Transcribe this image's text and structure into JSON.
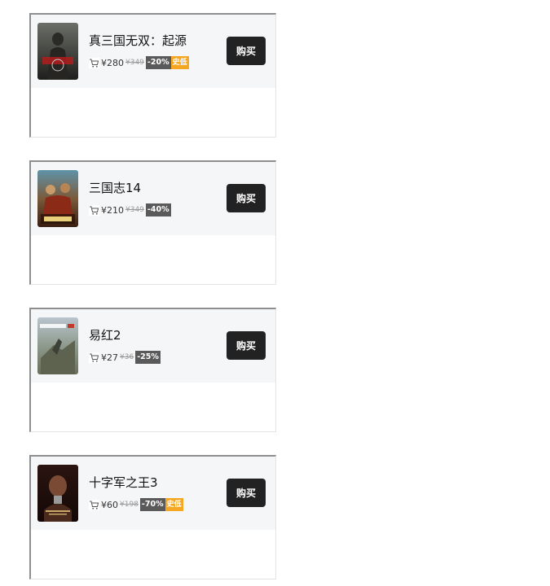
{
  "buy_label": "购买",
  "items": [
    {
      "title": "真三国无双：起源",
      "price": "¥280",
      "original_price": "¥349",
      "discount": "-20%",
      "historic_low": "史低",
      "cover_icon": "dynasty-warriors-cover-icon"
    },
    {
      "title": "三国志14",
      "price": "¥210",
      "original_price": "¥349",
      "discount": "-40%",
      "cover_icon": "romance-three-kingdoms-cover-icon"
    },
    {
      "title": "易红2",
      "price": "¥27",
      "original_price": "¥36",
      "discount": "-25%",
      "cover_icon": "easy-red-cover-icon"
    },
    {
      "title": "十字军之王3",
      "price": "¥60",
      "original_price": "¥198",
      "discount": "-70%",
      "historic_low": "史低",
      "cover_icon": "crusader-kings-cover-icon"
    }
  ],
  "colors": {
    "card_bg": "#f4f6f8",
    "buy_button": "#222222",
    "discount_badge": "#5a5a5a",
    "historic_low_badge": "#f5a623"
  }
}
